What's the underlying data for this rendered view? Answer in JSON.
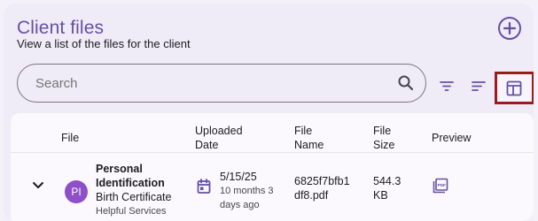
{
  "header": {
    "title": "Client files",
    "subtitle": "View a list of the files for the client"
  },
  "search": {
    "placeholder": "Search"
  },
  "icons": {
    "add": "add-circle-icon",
    "search": "search-icon",
    "filter": "filter-icon",
    "sort": "sort-icon",
    "columns": "table-columns-icon",
    "expand": "chevron-down-icon",
    "calendar": "calendar-icon",
    "pdf": "pdf-icon"
  },
  "colors": {
    "accent": "#6650a4",
    "avatar": "#8f4fc9",
    "highlight_border": "#9b1c1c"
  },
  "table": {
    "headers": {
      "file": "File",
      "uploaded_line1": "Uploaded",
      "uploaded_line2": "Date",
      "filename_line1": "File",
      "filename_line2": "Name",
      "filesize_line1": "File",
      "filesize_line2": "Size",
      "preview": "Preview"
    },
    "rows": [
      {
        "avatar_initials": "PI",
        "title_line1": "Personal",
        "title_line2": "Identification",
        "doc_type": "Birth Certificate",
        "source": "Helpful Services",
        "date": "5/15/25",
        "relative_line1": "10 months 3",
        "relative_line2": "days ago",
        "file_name_line1": "6825f7bfb1",
        "file_name_line2": "df8.pdf",
        "size_line1": "544.3",
        "size_line2": "KB"
      }
    ]
  }
}
